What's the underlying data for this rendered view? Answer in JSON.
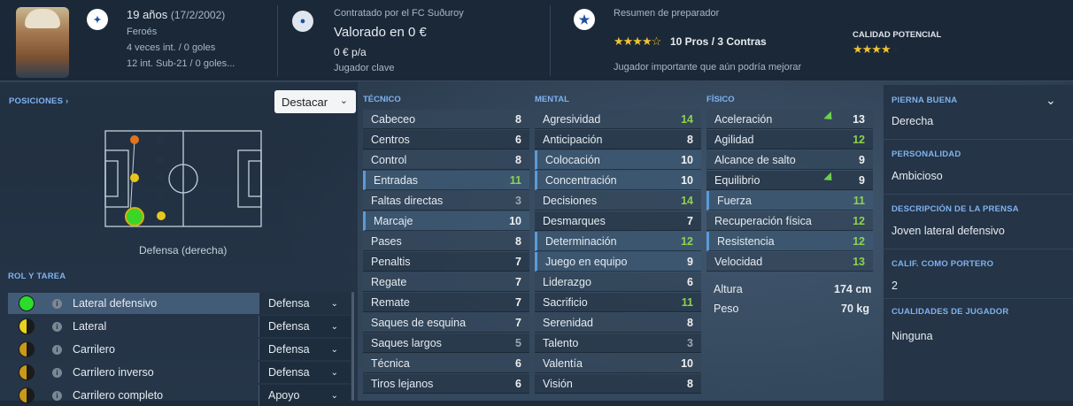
{
  "header": {
    "age": "19 años",
    "dob": "(17/2/2002)",
    "nationality": "Feroés",
    "caps": "4 veces int. / 0 goles",
    "u21": "12 int. Sub-21 / 0 goles...",
    "club": "Contratado por el FC Suðuroy",
    "value": "Valorado en 0 €",
    "wage": "0 € p/a",
    "status": "Jugador clave",
    "coach_title": "Resumen de preparador",
    "coach_stars": "★★★★☆",
    "coach_summary": "10 Pros / 3 Contras",
    "coach_note": "Jugador importante que aún podría mejorar",
    "potential_label": "CALIDAD POTENCIAL",
    "potential_stars": "★★★★★",
    "potential_rating": 4
  },
  "positions": {
    "title": "POSICIONES",
    "select": "Destacar",
    "position_label": "Defensa (derecha)"
  },
  "roles": {
    "title": "ROL Y TAREA",
    "items": [
      {
        "name": "Lateral defensivo",
        "duty": "Defensa",
        "icon": "green-circle"
      },
      {
        "name": "Lateral",
        "duty": "Defensa",
        "icon": "yellow-half"
      },
      {
        "name": "Carrilero",
        "duty": "Defensa",
        "icon": "gold-half"
      },
      {
        "name": "Carrilero inverso",
        "duty": "Defensa",
        "icon": "gold-half"
      },
      {
        "name": "Carrilero completo",
        "duty": "Apoyo",
        "icon": "gold-half"
      }
    ]
  },
  "technical": {
    "title": "TÉCNICO",
    "items": [
      {
        "name": "Cabeceo",
        "value": "8"
      },
      {
        "name": "Centros",
        "value": "6"
      },
      {
        "name": "Control",
        "value": "8"
      },
      {
        "name": "Entradas",
        "value": "11"
      },
      {
        "name": "Faltas directas",
        "value": "3"
      },
      {
        "name": "Marcaje",
        "value": "10"
      },
      {
        "name": "Pases",
        "value": "8"
      },
      {
        "name": "Penaltis",
        "value": "7"
      },
      {
        "name": "Regate",
        "value": "7"
      },
      {
        "name": "Remate",
        "value": "7"
      },
      {
        "name": "Saques de esquina",
        "value": "7"
      },
      {
        "name": "Saques largos",
        "value": "5"
      },
      {
        "name": "Técnica",
        "value": "6"
      },
      {
        "name": "Tiros lejanos",
        "value": "6"
      }
    ]
  },
  "mental": {
    "title": "MENTAL",
    "items": [
      {
        "name": "Agresividad",
        "value": "14"
      },
      {
        "name": "Anticipación",
        "value": "8"
      },
      {
        "name": "Colocación",
        "value": "10"
      },
      {
        "name": "Concentración",
        "value": "10"
      },
      {
        "name": "Decisiones",
        "value": "14"
      },
      {
        "name": "Desmarques",
        "value": "7"
      },
      {
        "name": "Determinación",
        "value": "12"
      },
      {
        "name": "Juego en equipo",
        "value": "9"
      },
      {
        "name": "Liderazgo",
        "value": "6"
      },
      {
        "name": "Sacrificio",
        "value": "11"
      },
      {
        "name": "Serenidad",
        "value": "8"
      },
      {
        "name": "Talento",
        "value": "3"
      },
      {
        "name": "Valentía",
        "value": "10"
      },
      {
        "name": "Visión",
        "value": "8"
      }
    ]
  },
  "physical": {
    "title": "FÍSICO",
    "items": [
      {
        "name": "Aceleración",
        "value": "13"
      },
      {
        "name": "Agilidad",
        "value": "12"
      },
      {
        "name": "Alcance de salto",
        "value": "9"
      },
      {
        "name": "Equilibrio",
        "value": "9"
      },
      {
        "name": "Fuerza",
        "value": "11"
      },
      {
        "name": "Recuperación física",
        "value": "12"
      },
      {
        "name": "Resistencia",
        "value": "12"
      },
      {
        "name": "Velocidad",
        "value": "13"
      }
    ],
    "height_label": "Altura",
    "height": "174 cm",
    "weight_label": "Peso",
    "weight": "70 kg"
  },
  "side": {
    "foot_label": "PIERNA BUENA",
    "foot": "Derecha",
    "personality_label": "PERSONALIDAD",
    "personality": "Ambicioso",
    "press_label": "DESCRIPCIÓN DE LA PRENSA",
    "press": "Joven lateral defensivo",
    "gk_label": "CALIF. COMO PORTERO",
    "gk": "2",
    "traits_label": "CUALIDADES DE JUGADOR",
    "traits": "Ninguna"
  },
  "colors": {
    "accent": "#7fb2f0",
    "good": "#8fd14f",
    "highlight": "#3c5670"
  }
}
